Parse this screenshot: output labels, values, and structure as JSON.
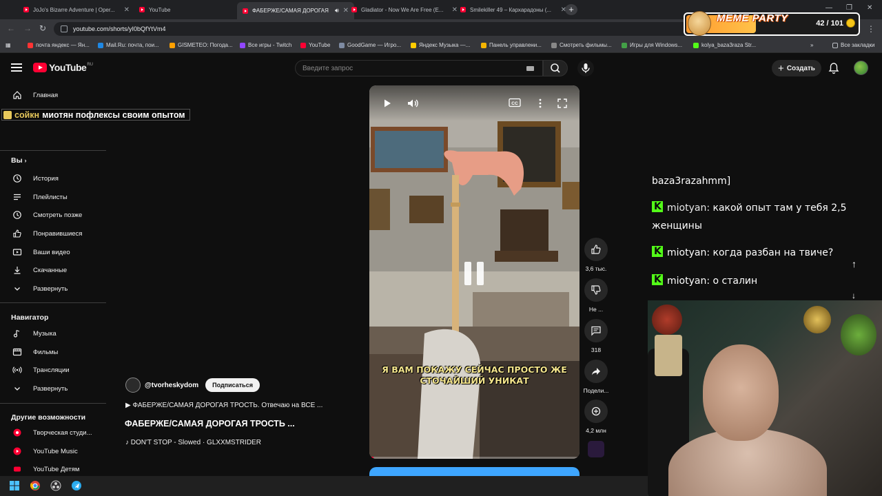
{
  "browser": {
    "tabs": [
      {
        "label": "JoJo's Bizarre Adventure | Oper...",
        "active": false
      },
      {
        "label": "YouTube",
        "active": false
      },
      {
        "label": "ФАБЕРЖЕ/САМАЯ ДОРОГАЯ",
        "active": true
      },
      {
        "label": "Gladiator - Now We Are Free (E...",
        "active": false
      },
      {
        "label": "Smilekiller 49 – Кархарадоны (...",
        "active": false
      }
    ],
    "url": "youtube.com/shorts/yI0bQfYtVm4",
    "bookmarks": [
      {
        "label": "почта яндекс — Ян...",
        "color": "#ff3333"
      },
      {
        "label": "Mail.Ru: почта, пои...",
        "color": "#1e88e5"
      },
      {
        "label": "GISMETEO: Погода...",
        "color": "#ffa000"
      },
      {
        "label": "Все игры - Twitch",
        "color": "#9146ff"
      },
      {
        "label": "YouTube",
        "color": "#ff0033"
      },
      {
        "label": "GoodGame — Игро...",
        "color": "#7e8ba3"
      },
      {
        "label": "Яндекс Музыка —...",
        "color": "#ffcc00"
      },
      {
        "label": "Панель управлени...",
        "color": "#f4b400"
      },
      {
        "label": "Смотреть фильмы...",
        "color": "#888888"
      },
      {
        "label": "Игры для Windows...",
        "color": "#43a047"
      },
      {
        "label": "kolya_baza3raza Str...",
        "color": "#53fc18"
      }
    ],
    "all_bookmarks": "Все закладки"
  },
  "youtube": {
    "logo": "YouTube",
    "region": "RU",
    "search_placeholder": "Введите запрос",
    "create_label": "Создать",
    "sidebar": {
      "home": "Главная",
      "you_heading": "Вы",
      "you_items": [
        "История",
        "Плейлисты",
        "Смотреть позже",
        "Понравившиеся",
        "Ваши видео",
        "Скачанные",
        "Развернуть"
      ],
      "navigator_heading": "Навигатор",
      "navigator_items": [
        "Музыка",
        "Фильмы",
        "Трансляции",
        "Развернуть"
      ],
      "other_heading": "Другие возможности",
      "other_items": [
        "Творческая студи...",
        "YouTube Music",
        "YouTube Детям"
      ]
    },
    "short": {
      "channel": "@tvorheskydom",
      "subscribe": "Подписаться",
      "description": "▶ ФАБЕРЖЕ/САМАЯ ДОРОГАЯ ТРОСТЬ. Отвечаю на ВСЕ ...",
      "title": "ФАБЕРЖЕ/САМАЯ ДОРОГАЯ ТРОСТЬ ...",
      "music": "♪ DON'T STOP - Slowed · GLXXMSTRIDER",
      "subtitle_line1": "Я ВАМ ПОКАЖУ СЕЙЧАС ПРОСТО ЖЕ",
      "subtitle_line2": "СТОЧАЙШИЙ УНИКАТ",
      "progress": 0.02,
      "actions": {
        "likes": "3,6 тыс.",
        "dislike": "Не ...",
        "comments": "318",
        "share": "Подели...",
        "remix": "4,2 млн"
      }
    }
  },
  "stream_overlay": {
    "caption": "миотян пофлексы своим опытом",
    "caption_partial": "сойкн",
    "meme_title": "MEME PARTY",
    "meme_count": "42 / 101",
    "meme_progress": 0.416,
    "chat": [
      {
        "user": "",
        "text": "baza3razahmm]"
      },
      {
        "user": "miotyan:",
        "text": "какой опыт там у тебя 2,5 женщины"
      },
      {
        "user": "miotyan:",
        "text": "когда разбан на твиче?"
      },
      {
        "user": "miotyan:",
        "text": "о сталин"
      }
    ]
  }
}
